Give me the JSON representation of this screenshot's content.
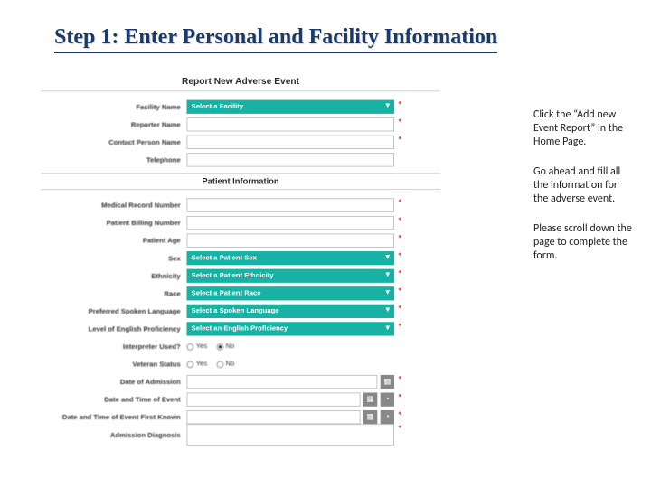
{
  "title": "Step 1: Enter Personal and Facility Information",
  "form": {
    "header": "Report New Adverse Event",
    "section2": "Patient Information",
    "labels": {
      "facility": "Facility Name",
      "reporter": "Reporter Name",
      "contact": "Contact Person Name",
      "telephone": "Telephone",
      "mrn": "Medical Record Number",
      "billing": "Patient Billing Number",
      "age": "Patient Age",
      "sex": "Sex",
      "ethnicity": "Ethnicity",
      "race": "Race",
      "language": "Preferred Spoken Language",
      "english": "Level of English Proficiency",
      "interpreter": "Interpreter Used?",
      "veteran": "Veteran Status",
      "admission": "Date of Admission",
      "event_dt": "Date and Time of Event",
      "known_dt": "Date and Time of Event First Known",
      "diagnosis": "Admission Diagnosis"
    },
    "selects": {
      "facility": "Select a Facility",
      "sex": "Select a Patient Sex",
      "ethnicity": "Select a Patient Ethnicity",
      "race": "Select a Patient Race",
      "language": "Select a Spoken Language",
      "english": "Select an English Proficiency"
    },
    "radios": {
      "yes": "Yes",
      "no": "No"
    }
  },
  "notes": {
    "p1": "Click the “Add new Event Report” in the Home Page.",
    "p2": "Go ahead and fill all the information for the adverse event.",
    "p3": "Please scroll down the page to complete the form."
  }
}
